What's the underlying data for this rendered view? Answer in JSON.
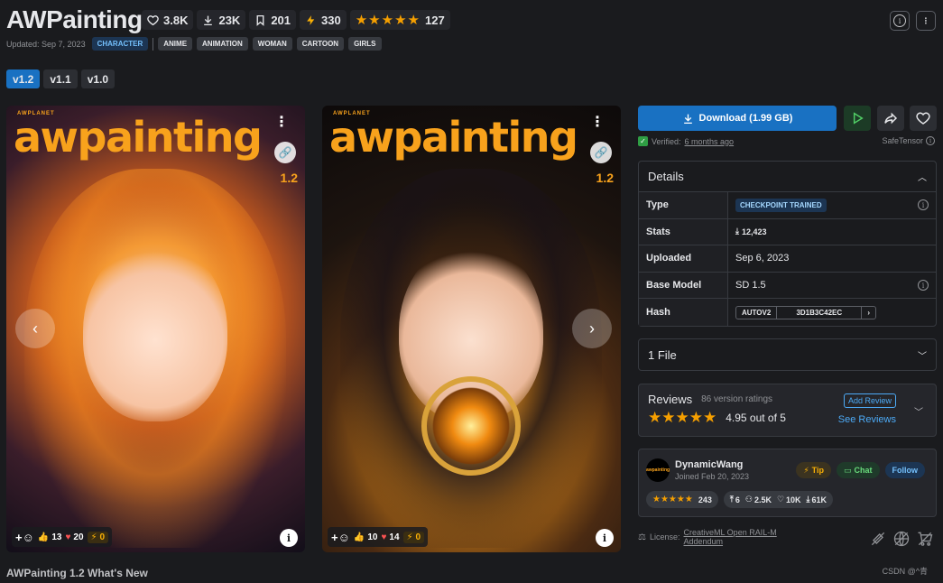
{
  "header": {
    "title": "AWPainting",
    "stats": {
      "likes": "3.8K",
      "downloads": "23K",
      "bookmarks": "201",
      "buzz": "330",
      "rating_stars": "★★★★★",
      "rating_count": "127"
    },
    "updated": "Updated: Sep 7, 2023",
    "primary_tag": "CHARACTER",
    "tags": [
      "ANIME",
      "ANIMATION",
      "WOMAN",
      "CARTOON",
      "GIRLS"
    ]
  },
  "versions": [
    "v1.2",
    "v1.1",
    "v1.0"
  ],
  "cards": [
    {
      "logo": "awpainting",
      "brand": "AWPLANET",
      "version": "1.2",
      "likes": "13",
      "hearts": "20",
      "buzz": "0"
    },
    {
      "logo": "awpainting",
      "brand": "AWPLANET",
      "version": "1.2",
      "likes": "10",
      "hearts": "14",
      "buzz": "0"
    }
  ],
  "download": {
    "label": "Download (1.99 GB)",
    "verified_label": "Verified:",
    "verified_time": "6 months ago",
    "format": "SafeTensor"
  },
  "details": {
    "title": "Details",
    "rows": {
      "type_label": "Type",
      "type_value": "CHECKPOINT TRAINED",
      "stats_label": "Stats",
      "stats_value": "12,423",
      "uploaded_label": "Uploaded",
      "uploaded_value": "Sep 6, 2023",
      "base_label": "Base Model",
      "base_value": "SD 1.5",
      "hash_label": "Hash",
      "hash_algo": "AUTOV2",
      "hash_value": "3D1B3C42EC"
    }
  },
  "files": {
    "label": "1 File"
  },
  "reviews": {
    "title": "Reviews",
    "count": "86 version ratings",
    "stars": "★★★★★",
    "score": "4.95 out of 5",
    "add": "Add Review",
    "see": "See Reviews"
  },
  "creator": {
    "name": "DynamicWang",
    "joined": "Joined Feb 20, 2023",
    "tip": "Tip",
    "chat": "Chat",
    "follow": "Follow",
    "rating_stars": "★★★★★",
    "rating_count": "243",
    "uploads": "6",
    "followers": "2.5K",
    "likes": "10K",
    "downloads": "61K",
    "avatar_text": "awpainting"
  },
  "license": {
    "label": "License:",
    "name": "CreativeML Open RAIL-M",
    "addendum": "Addendum"
  },
  "footer": {
    "whats_new": "AWPainting 1.2 What's New",
    "watermark": "CSDN @^青"
  },
  "colors": {
    "accent": "#1971c2",
    "star": "#f59f00",
    "logo": "#f8a21c"
  }
}
